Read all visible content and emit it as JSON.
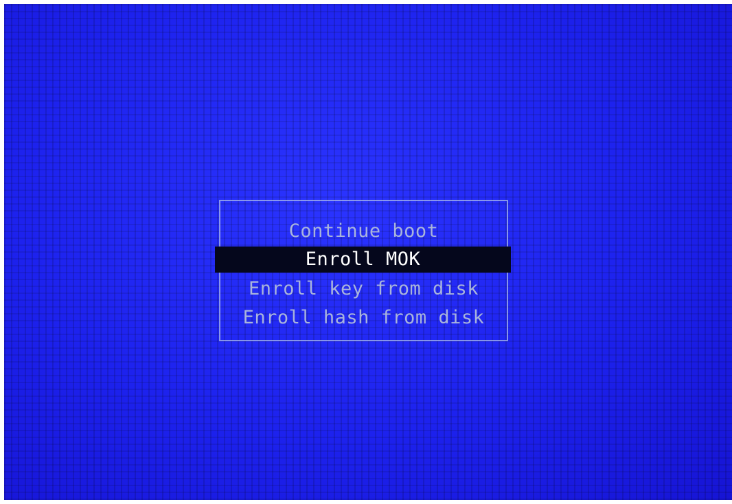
{
  "menu": {
    "items": [
      {
        "label": "Continue boot",
        "selected": false
      },
      {
        "label": "Enroll MOK",
        "selected": true
      },
      {
        "label": "Enroll key from disk",
        "selected": false
      },
      {
        "label": "Enroll hash from disk",
        "selected": false
      }
    ]
  },
  "colors": {
    "background": "#1d22ee",
    "border": "#aab9eb",
    "text": "#a9b4dc",
    "selected_bg": "#05071c",
    "selected_text": "#ffffff"
  }
}
